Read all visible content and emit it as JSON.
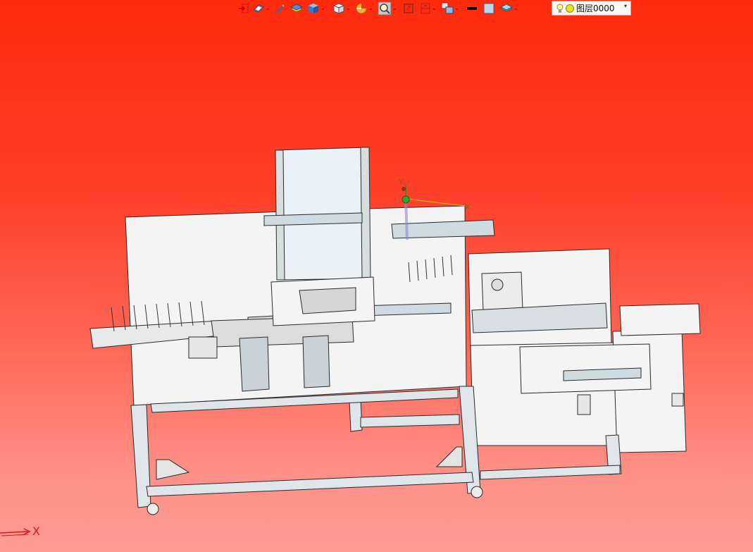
{
  "toolbar": {
    "buttons": [
      {
        "icon": "exit-icon"
      },
      {
        "icon": "view-orientation-icon",
        "dropdown": true
      },
      {
        "icon": "pen-icon"
      },
      {
        "icon": "shading-icon"
      },
      {
        "icon": "solid-box-icon",
        "dropdown": true
      },
      {
        "icon": "wireframe-box-icon",
        "dropdown": true
      },
      {
        "icon": "section-view-icon",
        "dropdown": true
      },
      {
        "icon": "zoom-icon",
        "dropdown": true
      },
      {
        "icon": "fit-view-icon"
      },
      {
        "icon": "split-view-icon",
        "dropdown": true
      },
      {
        "icon": "multi-window-icon",
        "dropdown": true
      },
      {
        "icon": "line-style-icon"
      },
      {
        "icon": "color-swatch-icon"
      },
      {
        "icon": "layer-stack-icon",
        "dropdown": true
      }
    ],
    "layer": {
      "name": "图层0000",
      "icons": [
        "light-bulb-icon",
        "sun-icon",
        "dropdown-arrow-icon"
      ]
    }
  },
  "viewport": {
    "background_top": "#ff2a0c",
    "background_bottom": "#ff9b94",
    "model": "machine-assembly",
    "triad_labels": {
      "y": "Y",
      "x": "X"
    },
    "axis_indicator": {
      "label": "X",
      "color": "#e51515"
    }
  }
}
